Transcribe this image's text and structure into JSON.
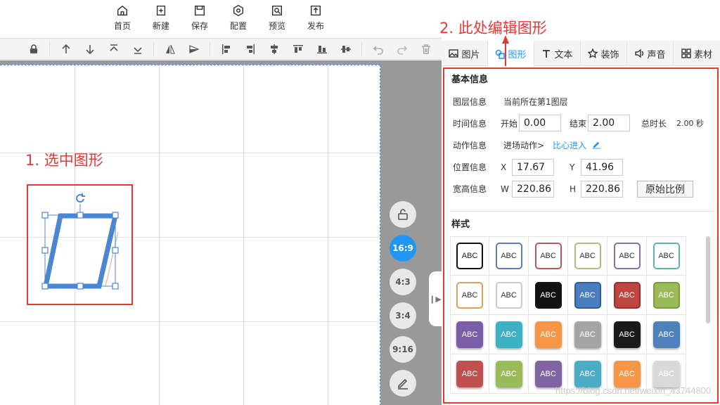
{
  "annotations": {
    "step1": "1. 选中图形",
    "step2": "2. 此处编辑图形"
  },
  "topbar": [
    {
      "label": "首页",
      "icon": "home-icon"
    },
    {
      "label": "新建",
      "icon": "new-file-icon"
    },
    {
      "label": "保存",
      "icon": "save-icon"
    },
    {
      "label": "配置",
      "icon": "settings-icon"
    },
    {
      "label": "预览",
      "icon": "preview-icon"
    },
    {
      "label": "发布",
      "icon": "publish-icon"
    }
  ],
  "toolbar": [
    "lock-icon",
    "move-up-icon",
    "move-down-icon",
    "move-top-icon",
    "move-bottom-icon",
    "flip-horizontal-icon",
    "flip-vertical-icon",
    "align-left-icon",
    "align-right-icon",
    "align-center-horizontal-icon",
    "align-top-icon",
    "align-bottom-icon",
    "align-center-vertical-icon",
    "undo-icon",
    "redo-icon",
    "delete-icon"
  ],
  "ratio_buttons": {
    "lock": "unlock-icon",
    "r169": "16:9",
    "r43": "4:3",
    "r34": "3:4",
    "r916": "9:16",
    "edit": "edit-icon"
  },
  "tabs": [
    {
      "label": "图片",
      "icon": "image-icon"
    },
    {
      "label": "图形",
      "icon": "shape-icon",
      "active": true
    },
    {
      "label": "文本",
      "icon": "text-icon"
    },
    {
      "label": "装饰",
      "icon": "decoration-icon"
    },
    {
      "label": "声音",
      "icon": "sound-icon"
    },
    {
      "label": "素材",
      "icon": "material-icon"
    }
  ],
  "basic": {
    "title": "基本信息",
    "layer_label": "图层信息",
    "layer_value": "当前所在第1图层",
    "time_label": "时间信息",
    "start_label": "开始",
    "start_value": "0.00",
    "end_label": "结束",
    "end_value": "2.00",
    "total_label": "总时长",
    "total_value": "2.00 秒",
    "action_label": "动作信息",
    "enter_label": "进场动作>",
    "enter_value": "比心进入",
    "pos_label": "位置信息",
    "x_label": "X",
    "x_value": "17.67",
    "y_label": "Y",
    "y_value": "41.96",
    "size_label": "宽高信息",
    "w_label": "W",
    "w_value": "220.86",
    "h_label": "H",
    "h_value": "220.86",
    "ratio_button": "原始比例"
  },
  "style": {
    "title": "样式",
    "swatch_text": "ABC",
    "swatches": [
      {
        "bg": "#ffffff",
        "border": "#111111",
        "fg": "#222222"
      },
      {
        "bg": "#ffffff",
        "border": "#5b7db1",
        "fg": "#333333"
      },
      {
        "bg": "#ffffff",
        "border": "#b55a5a",
        "fg": "#333333"
      },
      {
        "bg": "#ffffff",
        "border": "#a9c07a",
        "fg": "#333333"
      },
      {
        "bg": "#ffffff",
        "border": "#8a6fa8",
        "fg": "#333333"
      },
      {
        "bg": "#ffffff",
        "border": "#5fb0b7",
        "fg": "#333333"
      },
      {
        "bg": "#ffffff",
        "border": "#e0a15e",
        "fg": "#333333"
      },
      {
        "bg": "#ffffff",
        "border": "#cccccc",
        "fg": "#333333"
      },
      {
        "bg": "#111111",
        "border": "#111111",
        "fg": "#ffffff"
      },
      {
        "bg": "#4a7cc0",
        "border": "#2f5a9a",
        "fg": "#ffffff"
      },
      {
        "bg": "#c0443f",
        "border": "#9a2f2b",
        "fg": "#ffffff"
      },
      {
        "bg": "#9bbb59",
        "border": "#7a9a3d",
        "fg": "#ffffff"
      },
      {
        "bg": "#7b5ea7",
        "border": "#7b5ea7",
        "fg": "#ffffff"
      },
      {
        "bg": "#3cb1c3",
        "border": "#3cb1c3",
        "fg": "#ffffff"
      },
      {
        "bg": "#f79646",
        "border": "#f79646",
        "fg": "#ffffff"
      },
      {
        "bg": "#a5a5a5",
        "border": "#a5a5a5",
        "fg": "#ffffff"
      },
      {
        "bg": "#1a1a1a",
        "border": "#1a1a1a",
        "fg": "#ffffff"
      },
      {
        "bg": "#4f81bd",
        "border": "#4f81bd",
        "fg": "#ffffff"
      },
      {
        "bg": "#c0504d",
        "border": "#c0504d",
        "fg": "#ffffff"
      },
      {
        "bg": "#9bbb59",
        "border": "#9bbb59",
        "fg": "#ffffff"
      },
      {
        "bg": "#8064a2",
        "border": "#8064a2",
        "fg": "#ffffff"
      },
      {
        "bg": "#4bacc6",
        "border": "#4bacc6",
        "fg": "#ffffff"
      },
      {
        "bg": "#f79646",
        "border": "#f79646",
        "fg": "#ffffff"
      },
      {
        "bg": "#d9d9d9",
        "border": "#d9d9d9",
        "fg": "#ffffff"
      }
    ]
  },
  "watermark": "https://blog.csdn.net/weixin_43744800"
}
